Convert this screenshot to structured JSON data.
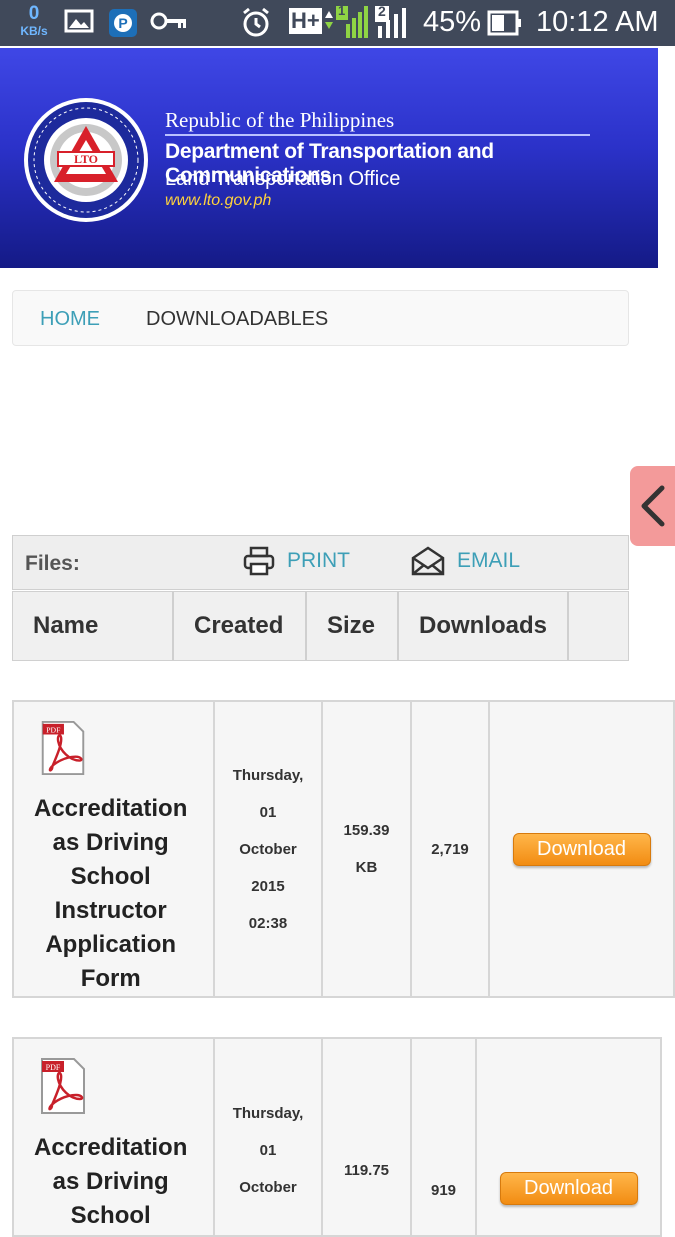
{
  "status_bar": {
    "speed_value": "0",
    "speed_unit": "KB/s",
    "net_type": "H+",
    "sim1": "1",
    "sim2": "2",
    "battery": "45%",
    "time": "10:12 AM"
  },
  "header": {
    "line1": "Republic of the Philippines",
    "line2": "Department of Transportation and Communications",
    "line3": "Land Transportation Office",
    "url": "www.lto.gov.ph",
    "logo_text": "LTO",
    "brand_color": "#2b32c9"
  },
  "breadcrumb": {
    "home": "HOME",
    "current": "DOWNLOADABLES"
  },
  "files": {
    "label": "Files:",
    "print": "PRINT",
    "email": "EMAIL",
    "columns": [
      "Name",
      "Created",
      "Size",
      "Downloads"
    ],
    "rows": [
      {
        "name_lines": [
          "Accreditation",
          "as Driving",
          "School",
          "Instructor",
          "Application",
          "Form"
        ],
        "created_lines": [
          "Thursday,",
          "01",
          "October",
          "2015",
          "02:38"
        ],
        "size_lines": [
          "159.39",
          "KB"
        ],
        "downloads": "2,719",
        "button": "Download"
      },
      {
        "name_lines": [
          "Accreditation",
          "as Driving",
          "School"
        ],
        "created_lines": [
          "Thursday,",
          "01",
          "October"
        ],
        "size_lines": [
          "119.75"
        ],
        "downloads": "919",
        "button": "Download"
      }
    ]
  },
  "accent_color": "#3d9fb7",
  "button_color": "#f28c12"
}
